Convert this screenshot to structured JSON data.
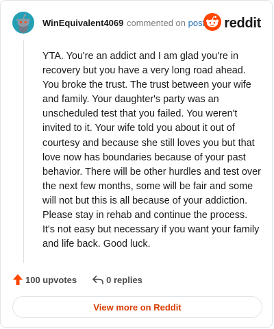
{
  "comment": {
    "author": "WinEquivalent4069",
    "commented_on_text": "commented on",
    "post_link_label": "post",
    "body": "YTA. You're an addict and I am glad you're in recovery but you have a very long road ahead. You broke the trust. The trust between your wife and family. Your daughter's party was an unscheduled test that you failed. You weren't invited to it. Your wife told you about it out of courtesy and because she still loves you but that love now has boundaries because of your past behavior. There will be other hurdles and test over the next few months, some will be fair and some will not but this is all because of your addiction. Please stay in rehab and continue the process. It's not easy but necessary if you want your family and life back. Good luck.",
    "upvotes_label": "100 upvotes",
    "replies_label": "0 replies"
  },
  "brand": {
    "wordmark": "reddit",
    "icon": "reddit-logo-icon",
    "color": "#ff4500"
  },
  "avatar": {
    "icon": "snoo-avatar-icon",
    "background": "#24a0b4"
  },
  "actions": {
    "upvote_icon": "upvote-arrow-icon",
    "upvote_color": "#ff4500",
    "reply_icon": "reply-arrow-icon"
  },
  "footer": {
    "view_more_label": "View more on Reddit",
    "accent": "#d93a00"
  }
}
